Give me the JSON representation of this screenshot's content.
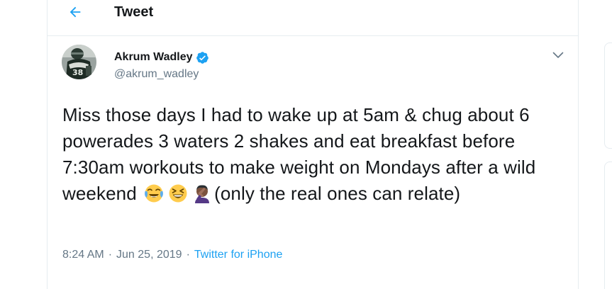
{
  "header": {
    "title": "Tweet",
    "back_icon": "arrow-left-icon"
  },
  "author": {
    "name": "Akrum Wadley",
    "handle": "@akrum_wadley",
    "verified": true,
    "jersey_number": "38"
  },
  "tweet": {
    "text_before_emoji": "Miss those days I had to wake up at 5am & chug about 6 powerades 3 waters 2 shakes and eat breakfast before 7:30am workouts to make weight on Mondays after a wild weekend",
    "emojis": [
      "face-with-tears-of-joy-emoji",
      "grinning-squinting-face-emoji",
      "person-facepalming-emoji"
    ],
    "text_after_emoji": "(only the real ones can relate)",
    "time": "8:24 AM",
    "date": "Jun 25, 2019",
    "separator": "·",
    "source": "Twitter for iPhone"
  },
  "colors": {
    "accent": "#1da1f2",
    "secondary_text": "#657786",
    "primary_text": "#14171a",
    "border": "#e6ecf0"
  }
}
